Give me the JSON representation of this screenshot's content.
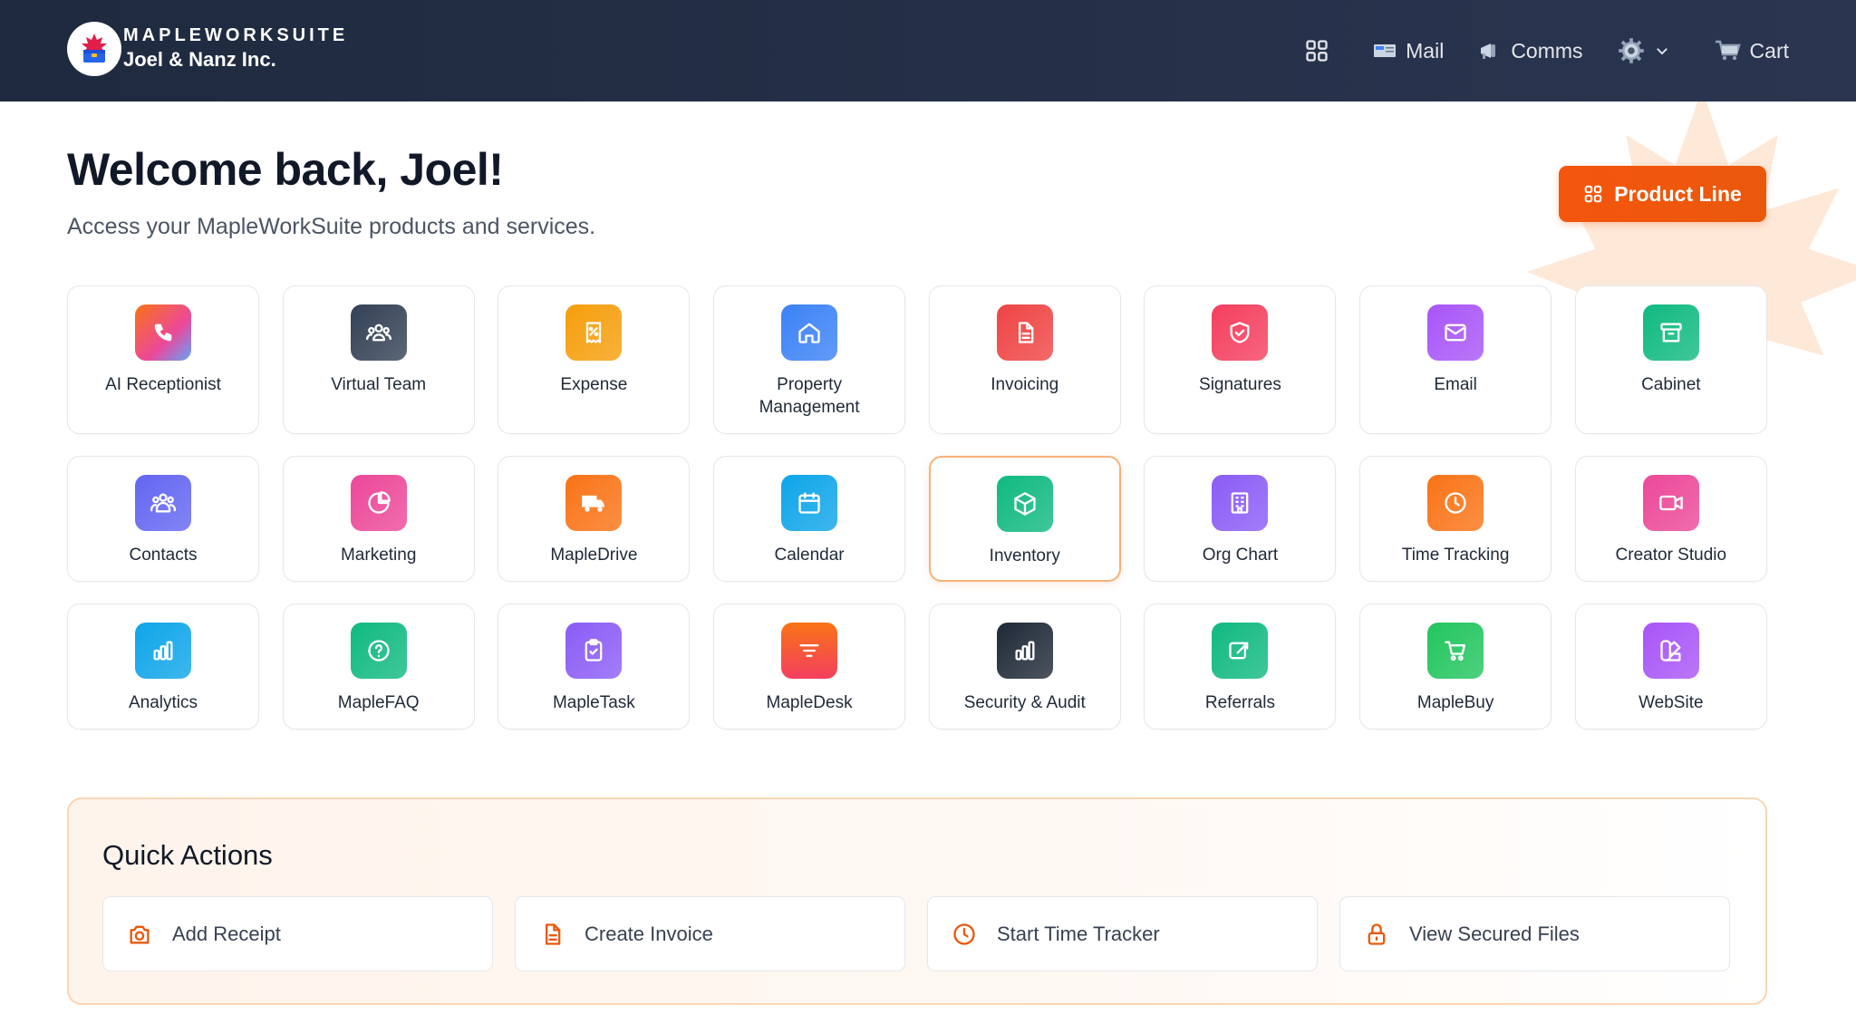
{
  "header": {
    "brand_name": "MAPLEWORKSUITE",
    "company": "Joel & Nanz Inc.",
    "nav": {
      "apps_icon": "grid-icon",
      "mail_label": "Mail",
      "comms_label": "Comms",
      "settings_icon": "gear-icon",
      "cart_label": "Cart"
    }
  },
  "welcome": {
    "title": "Welcome back, Joel!",
    "subtitle": "Access your MapleWorkSuite products and services."
  },
  "product_line_button": "Product Line",
  "apps": [
    {
      "label": "AI Receptionist",
      "icon": "phone-icon",
      "color": "#ef4444"
    },
    {
      "label": "Virtual Team",
      "icon": "team-icon",
      "color": "#334155"
    },
    {
      "label": "Expense",
      "icon": "receipt-icon",
      "color": "#f59e0b"
    },
    {
      "label": "Property Management",
      "icon": "home-icon",
      "color": "#3b82f6"
    },
    {
      "label": "Invoicing",
      "icon": "document-icon",
      "color": "#ef4444"
    },
    {
      "label": "Signatures",
      "icon": "shield-check-icon",
      "color": "#f43f5e"
    },
    {
      "label": "Email",
      "icon": "mail-icon",
      "color": "#a855f7"
    },
    {
      "label": "Cabinet",
      "icon": "archive-icon",
      "color": "#10b981"
    },
    {
      "label": "Contacts",
      "icon": "people-icon",
      "color": "#6366f1"
    },
    {
      "label": "Marketing",
      "icon": "pie-chart-icon",
      "color": "#ec4899"
    },
    {
      "label": "MapleDrive",
      "icon": "truck-icon",
      "color": "#f97316"
    },
    {
      "label": "Calendar",
      "icon": "calendar-icon",
      "color": "#0ea5e9"
    },
    {
      "label": "Inventory",
      "icon": "box-icon",
      "color": "#10b981"
    },
    {
      "label": "Org Chart",
      "icon": "building-icon",
      "color": "#8b5cf6"
    },
    {
      "label": "Time Tracking",
      "icon": "clock-icon",
      "color": "#f97316"
    },
    {
      "label": "Creator Studio",
      "icon": "video-icon",
      "color": "#ec4899"
    },
    {
      "label": "Analytics",
      "icon": "bar-chart-icon",
      "color": "#0ea5e9"
    },
    {
      "label": "MapleFAQ",
      "icon": "help-circle-icon",
      "color": "#10b981"
    },
    {
      "label": "MapleTask",
      "icon": "clipboard-check-icon",
      "color": "#8b5cf6"
    },
    {
      "label": "MapleDesk",
      "icon": "filter-icon",
      "color": "#f97316"
    },
    {
      "label": "Security & Audit",
      "icon": "bar-chart-icon",
      "color": "#1f2937"
    },
    {
      "label": "Referrals",
      "icon": "share-icon",
      "color": "#10b981"
    },
    {
      "label": "MapleBuy",
      "icon": "cart-icon",
      "color": "#22c55e"
    },
    {
      "label": "WebSite",
      "icon": "palette-icon",
      "color": "#a855f7"
    }
  ],
  "quick_actions": {
    "title": "Quick Actions",
    "items": [
      {
        "label": "Add Receipt",
        "icon": "camera-icon"
      },
      {
        "label": "Create Invoice",
        "icon": "document-icon"
      },
      {
        "label": "Start Time Tracker",
        "icon": "clock-icon"
      },
      {
        "label": "View Secured Files",
        "icon": "lock-icon"
      }
    ]
  },
  "accent_color": "#ea580c"
}
